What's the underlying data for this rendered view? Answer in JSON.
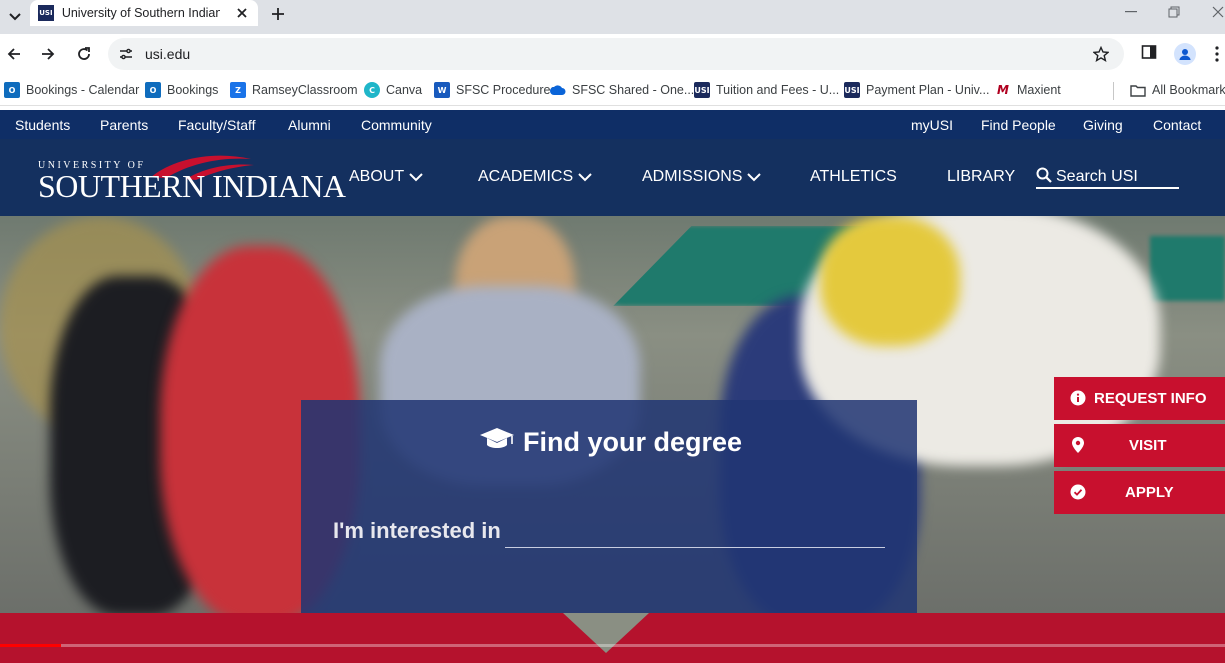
{
  "browser": {
    "tab_title": "University of Southern Indiana |",
    "tab_favicon_text": "USI",
    "url": "usi.edu",
    "bookmarks": [
      {
        "label": "Bookings - Calendar",
        "icon": "outlook-icon",
        "color": "#0f6cbd"
      },
      {
        "label": "Bookings",
        "icon": "outlook-icon",
        "color": "#0f6cbd"
      },
      {
        "label": "RamseyClassroom",
        "icon": "ramsey-icon",
        "color": "#1a73e8"
      },
      {
        "label": "Canva",
        "icon": "canva-icon",
        "color": "#1fb6c9"
      },
      {
        "label": "SFSC Procedures",
        "icon": "word-icon",
        "color": "#185abd"
      },
      {
        "label": "SFSC Shared - One...",
        "icon": "onedrive-icon",
        "color": "#0a64d8"
      },
      {
        "label": "Tuition and Fees - U...",
        "icon": "usi-icon",
        "color": "#1b2a5c"
      },
      {
        "label": "Payment Plan - Univ...",
        "icon": "usi-icon",
        "color": "#1b2a5c"
      },
      {
        "label": "Maxient",
        "icon": "maxient-icon",
        "color": "#b00020"
      },
      {
        "label": "All Bookmarks",
        "icon": "folder-icon",
        "color": "#5f6368"
      }
    ]
  },
  "site": {
    "colors": {
      "navy": "#14305f",
      "utility_navy": "#0f2e66",
      "red": "#c8102e"
    },
    "utility_left": [
      "Students",
      "Parents",
      "Faculty/Staff",
      "Alumni",
      "Community"
    ],
    "utility_right": [
      "myUSI",
      "Find People",
      "Giving",
      "Contact"
    ],
    "logo": {
      "small": "UNIVERSITY OF",
      "big": "SOUTHERN INDIANA"
    },
    "nav": [
      {
        "label": "ABOUT",
        "dropdown": true
      },
      {
        "label": "ACADEMICS",
        "dropdown": true
      },
      {
        "label": "ADMISSIONS",
        "dropdown": true
      },
      {
        "label": "ATHLETICS",
        "dropdown": false
      },
      {
        "label": "LIBRARY",
        "dropdown": false
      }
    ],
    "search_label": "Search USI",
    "degree": {
      "title": "Find your degree",
      "interest_label": "I'm interested in",
      "interest_value": ""
    },
    "cta": [
      {
        "label": "REQUEST INFO",
        "icon": "info-icon"
      },
      {
        "label": "VISIT",
        "icon": "location-pin-icon"
      },
      {
        "label": "APPLY",
        "icon": "check-circle-icon"
      }
    ],
    "video_progress": 0.05
  }
}
